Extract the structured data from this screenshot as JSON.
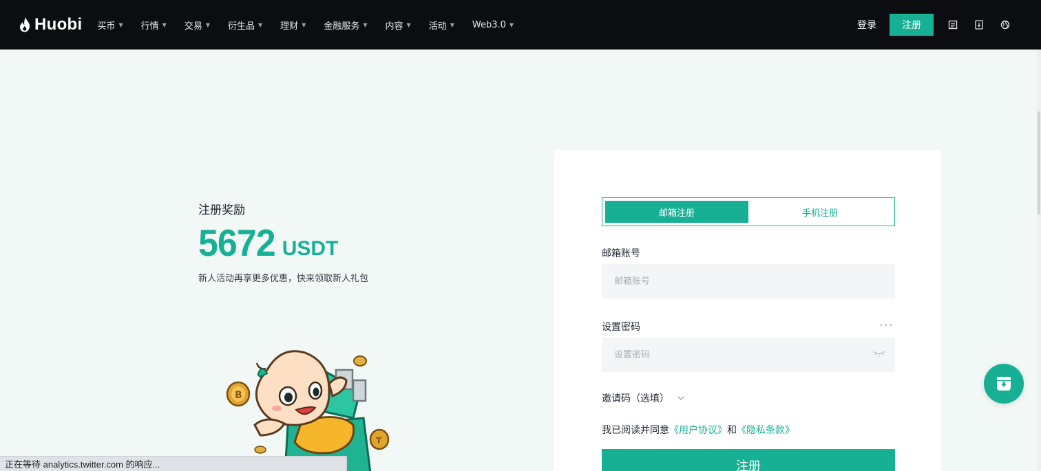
{
  "navbar": {
    "logo_text": "Huobi",
    "items": [
      {
        "label": "买币"
      },
      {
        "label": "行情"
      },
      {
        "label": "交易"
      },
      {
        "label": "衍生品"
      },
      {
        "label": "理财"
      },
      {
        "label": "金融服务"
      },
      {
        "label": "内容"
      },
      {
        "label": "活动"
      },
      {
        "label": "Web3.0"
      }
    ],
    "login_label": "登录",
    "register_label": "注册",
    "icons": [
      "orders-icon",
      "download-icon",
      "language-globe-icon"
    ],
    "accent_color": "#18b095",
    "background_color": "#0b0d11"
  },
  "hero": {
    "title": "注册奖励",
    "amount": "5672",
    "unit": "USDT",
    "subtitle": "新人活动再享更多优惠，快来领取新人礼包"
  },
  "form": {
    "tabs": [
      {
        "label": "邮箱注册",
        "active": true
      },
      {
        "label": "手机注册",
        "active": false
      }
    ],
    "email_label": "邮箱账号",
    "email_placeholder": "邮箱账号",
    "password_label": "设置密码",
    "password_placeholder": "设置密码",
    "invite_label": "邀请码（选填）",
    "agree_prefix": "我已阅读并同意",
    "user_agreement": "《用户协议》",
    "agree_and": "和",
    "privacy_policy": "《隐私条款》",
    "submit_label": "注册"
  },
  "status_bar": {
    "text": "正在等待 analytics.twitter.com 的响应..."
  }
}
